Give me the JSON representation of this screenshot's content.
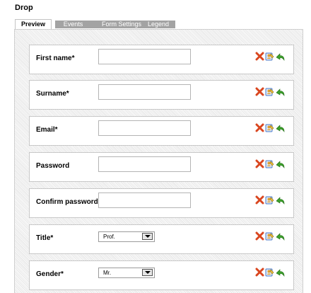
{
  "page": {
    "title": "Drop"
  },
  "tabs": [
    {
      "label": "Preview",
      "active": true
    },
    {
      "label": "Events",
      "active": false
    },
    {
      "label": "Form Settings",
      "active": false
    },
    {
      "label": "Legend",
      "active": false
    }
  ],
  "fields": [
    {
      "label": "First name*",
      "type": "text",
      "value": ""
    },
    {
      "label": "Surname*",
      "type": "text",
      "value": ""
    },
    {
      "label": "Email*",
      "type": "text",
      "value": ""
    },
    {
      "label": "Password",
      "type": "text",
      "value": ""
    },
    {
      "label": "Confirm password*",
      "type": "text",
      "value": ""
    },
    {
      "label": "Title*",
      "type": "select",
      "value": "Prof."
    },
    {
      "label": "Gender*",
      "type": "select",
      "value": "Mr."
    }
  ],
  "row_actions": [
    "delete-icon",
    "edit-icon",
    "copy-icon"
  ],
  "colors": {
    "delete": "#d9461f",
    "copy": "#3ca12b",
    "edit": "#4a79c9",
    "tab_inactive": "#a3a3a3"
  }
}
